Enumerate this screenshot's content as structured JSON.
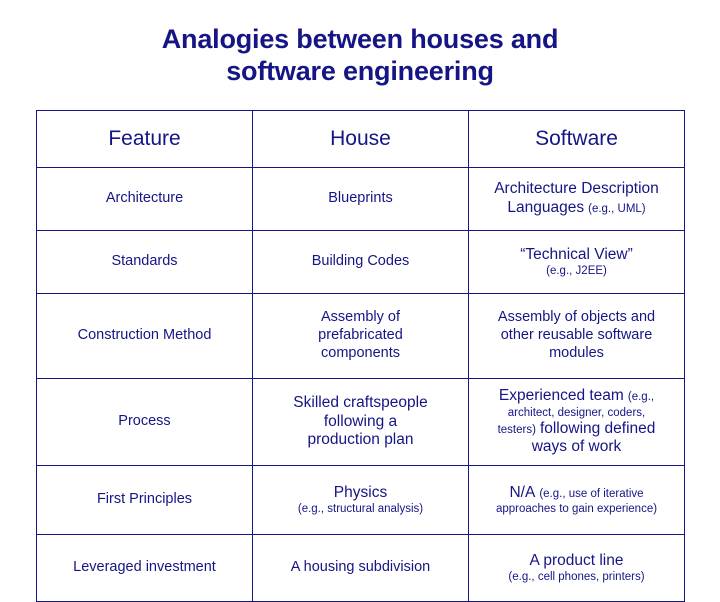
{
  "slide": {
    "title_line1": "Analogies between houses and",
    "title_line2": "software engineering",
    "title_color": "#151585"
  },
  "table": {
    "headers": [
      "Feature",
      "House",
      "Software"
    ],
    "rows": [
      {
        "feature": "Architecture",
        "house": "Blueprints",
        "software_main": "Architecture Description",
        "software_main2": "Languages",
        "software_note": "(e.g., UML)"
      },
      {
        "feature": "Standards",
        "house": "Building Codes",
        "software_main": "“Technical View”",
        "software_note": "(e.g., J2EE)"
      },
      {
        "feature": "Construction Method",
        "house_line1": "Assembly of",
        "house_line2": "prefabricated",
        "house_line3": "components",
        "software_line1": "Assembly of objects and",
        "software_line2": "other reusable software",
        "software_line3": "modules"
      },
      {
        "feature": "Process",
        "house_line1": "Skilled craftspeople",
        "house_line2": "following a",
        "house_line3": "production plan",
        "software_main": "Experienced team",
        "software_note1": "(e.g.,",
        "software_note2": "architect, designer, coders,",
        "software_note3": "testers)",
        "software_main2": "following defined",
        "software_main3": "ways of work"
      },
      {
        "feature": "First Principles",
        "house_main": "Physics",
        "house_note": "(e.g., structural analysis)",
        "software_main": "N/A",
        "software_note1": "(e.g., use of iterative",
        "software_note2": "approaches to gain experience)"
      },
      {
        "feature": "Leveraged investment",
        "house": "A housing subdivision",
        "software_main": "A product line",
        "software_note": "(e.g., cell phones, printers)"
      }
    ]
  }
}
